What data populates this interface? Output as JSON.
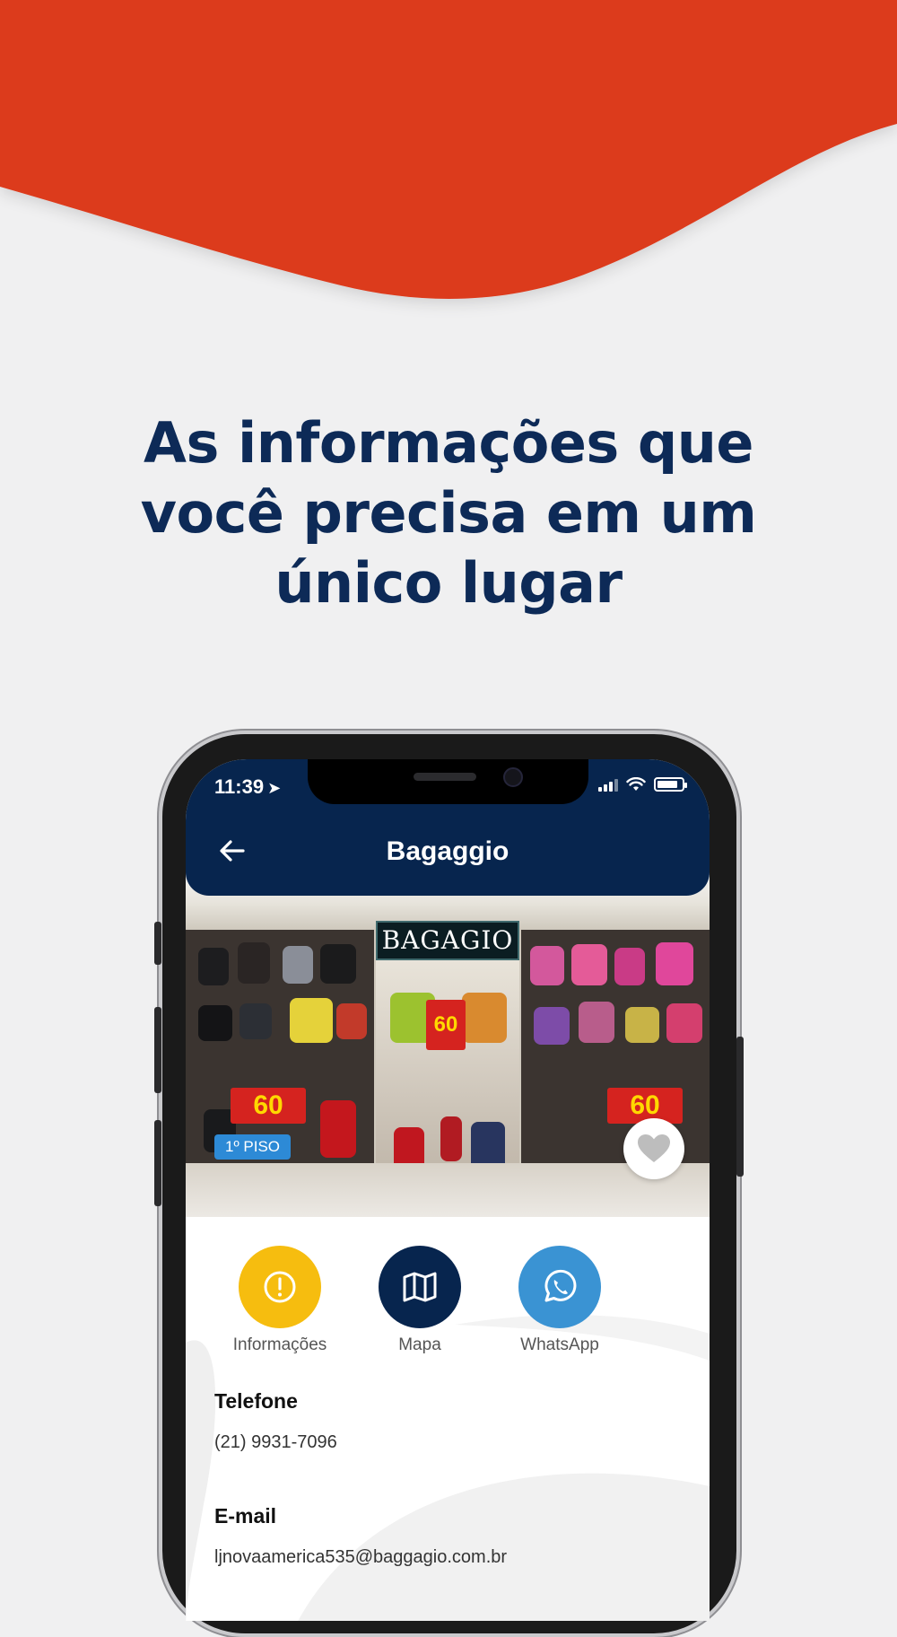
{
  "headline": {
    "line1": "As informações que",
    "line2": "você precisa em um",
    "line3": "único lugar"
  },
  "colors": {
    "brand_red": "#dc3a1d",
    "header_navy": "#07254e",
    "headline_navy": "#0d2a57",
    "info_yellow": "#f6bd0f",
    "map_navy": "#07254e",
    "whatsapp_blue": "#3a93d3"
  },
  "status_bar": {
    "time": "11:39",
    "icons": [
      "location-arrow-icon",
      "cellular-signal-icon",
      "wifi-icon",
      "battery-icon"
    ]
  },
  "app": {
    "title": "Bagaggio",
    "back_icon": "arrow-left-icon"
  },
  "store_photo": {
    "sign_text": "BAGAGIO",
    "promo_left": "60",
    "promo_right": "60",
    "promo_center": "60",
    "floor_badge": "1º PISO",
    "favorite_icon": "heart-icon"
  },
  "actions": [
    {
      "label": "Informações",
      "icon": "info-icon"
    },
    {
      "label": "Mapa",
      "icon": "map-icon"
    },
    {
      "label": "WhatsApp",
      "icon": "whatsapp-icon"
    }
  ],
  "details": {
    "phone_label": "Telefone",
    "phone_value": "(21) 9931-7096",
    "email_label": "E-mail",
    "email_value": "ljnovaamerica535@baggagio.com.br"
  }
}
